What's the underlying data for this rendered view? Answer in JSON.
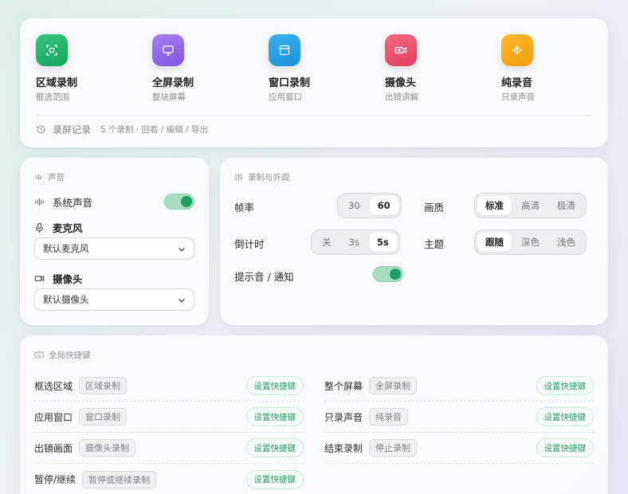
{
  "modes": [
    {
      "icon": "region-capture-icon",
      "title": "区域录制",
      "subtitle": "框选范围",
      "color_from": "#34c77f",
      "color_to": "#17a35e"
    },
    {
      "icon": "monitor-icon",
      "title": "全屏录制",
      "subtitle": "整块屏幕",
      "color_from": "#a77ff2",
      "color_to": "#7b57e0"
    },
    {
      "icon": "window-icon",
      "title": "窗口录制",
      "subtitle": "应用窗口",
      "color_from": "#39b3ee",
      "color_to": "#1b8fd8"
    },
    {
      "icon": "camera-icon",
      "title": "摄像头",
      "subtitle": "出镜讲解",
      "color_from": "#f26a82",
      "color_to": "#e0405e"
    },
    {
      "icon": "audio-wave-icon",
      "title": "纯录音",
      "subtitle": "只录声音",
      "color_from": "#fbbb2e",
      "color_to": "#f09d0c"
    }
  ],
  "history": {
    "label": "录屏记录",
    "detail": "5 个录制 · 回看 / 编辑 / 导出"
  },
  "audio": {
    "section_title": "声音",
    "system_sound": {
      "label": "系统声音",
      "enabled": true
    },
    "microphone": {
      "label": "麦克风",
      "value": "默认麦克风"
    },
    "camera": {
      "label": "摄像头",
      "value": "默认摄像头"
    }
  },
  "recording": {
    "section_title": "录制与外观",
    "fps": {
      "label": "帧率",
      "options": [
        "30",
        "60"
      ],
      "selected": "60"
    },
    "quality": {
      "label": "画质",
      "options": [
        "标准",
        "高清",
        "极清"
      ],
      "selected": "标准"
    },
    "countdown": {
      "label": "倒计时",
      "options": [
        "关",
        "3s",
        "5s"
      ],
      "selected": "5s"
    },
    "theme": {
      "label": "主题",
      "options": [
        "跟随",
        "深色",
        "浅色"
      ],
      "selected": "跟随"
    },
    "notify": {
      "label": "提示音 / 通知",
      "enabled": true
    }
  },
  "shortcuts": {
    "section_title": "全局快捷键",
    "button_label": "设置快捷键",
    "left": [
      {
        "name": "框选区域",
        "action": "区域录制"
      },
      {
        "name": "应用窗口",
        "action": "窗口录制"
      },
      {
        "name": "出镜画面",
        "action": "摄像头录制"
      },
      {
        "name": "暂停/继续",
        "action": "暂停或继续录制"
      }
    ],
    "right": [
      {
        "name": "整个屏幕",
        "action": "全屏录制"
      },
      {
        "name": "只录声音",
        "action": "纯录音"
      },
      {
        "name": "结束录制",
        "action": "停止录制"
      }
    ]
  },
  "accent": "#1f9d66"
}
